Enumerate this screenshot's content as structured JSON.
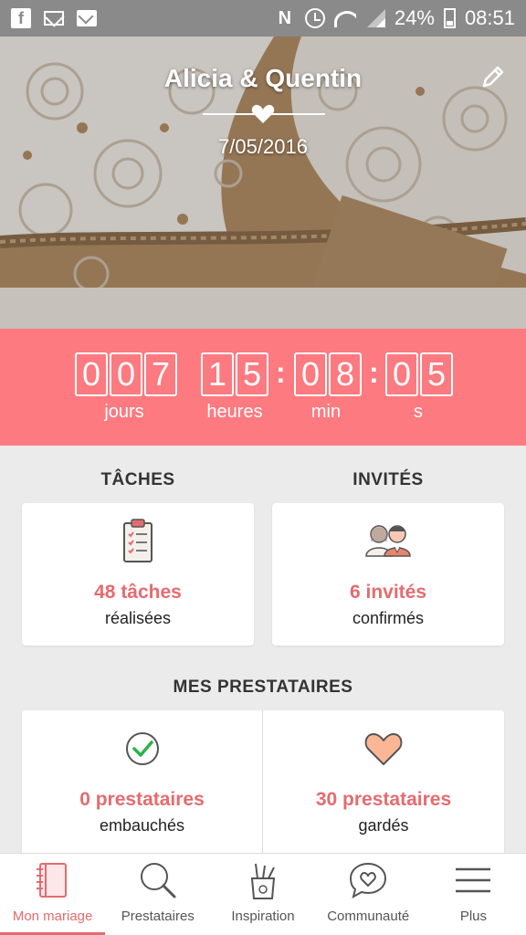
{
  "status_bar": {
    "battery": "24%",
    "time": "08:51",
    "left_icons": [
      "facebook-icon",
      "mail-icon",
      "gmail-icon"
    ],
    "right_icons": [
      "nfc-icon",
      "alarm-icon",
      "wifi-icon",
      "signal-icon",
      "battery-icon"
    ]
  },
  "hero": {
    "title": "Alicia & Quentin",
    "date": "7/05/2016"
  },
  "countdown": {
    "days": [
      "0",
      "0",
      "7"
    ],
    "hours": [
      "1",
      "5"
    ],
    "minutes": [
      "0",
      "8"
    ],
    "seconds": [
      "0",
      "5"
    ],
    "days_label": "jours",
    "hours_label": "heures",
    "minutes_label": "min",
    "seconds_label": "s"
  },
  "tasks": {
    "title": "TÂCHES",
    "value": "48 tâches",
    "sub": "réalisées"
  },
  "guests": {
    "title": "INVITÉS",
    "value": "6 invités",
    "sub": "confirmés"
  },
  "vendors": {
    "title": "MES PRESTATAIRES",
    "hired_value": "0 prestataires",
    "hired_sub": "embauchés",
    "saved_value": "30 prestataires",
    "saved_sub": "gardés"
  },
  "nav": {
    "items": [
      {
        "label": "Mon mariage",
        "icon": "notebook-icon",
        "active": true
      },
      {
        "label": "Prestataires",
        "icon": "search-icon",
        "active": false
      },
      {
        "label": "Inspiration",
        "icon": "pencil-cup-icon",
        "active": false
      },
      {
        "label": "Communauté",
        "icon": "chat-heart-icon",
        "active": false
      },
      {
        "label": "Plus",
        "icon": "menu-icon",
        "active": false
      }
    ]
  },
  "colors": {
    "accent": "#fc7a80",
    "accent_text": "#e56b6f",
    "status_bar": "#8a8a8a"
  }
}
